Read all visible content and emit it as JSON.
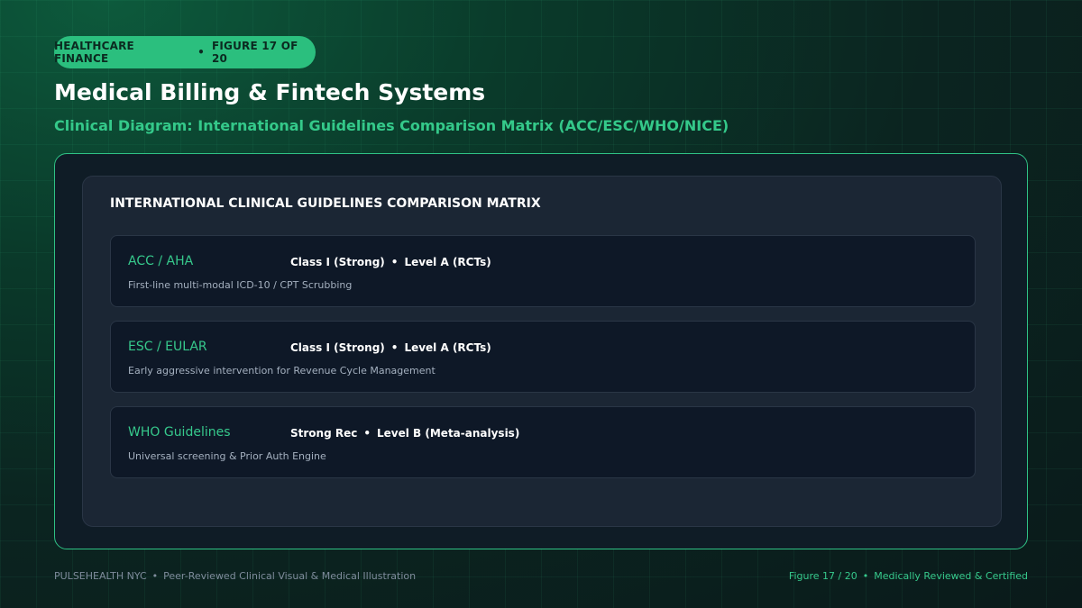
{
  "badge": {
    "section": "HEALTHCARE FINANCE",
    "separator": "•",
    "figure": "FIGURE 17 OF 20"
  },
  "header": {
    "title": "Medical Billing & Fintech Systems",
    "subtitle": "Clinical Diagram: International Guidelines Comparison Matrix (ACC/ESC/WHO/NICE)"
  },
  "matrix": {
    "heading": "INTERNATIONAL CLINICAL GUIDELINES COMPARISON MATRIX",
    "rows": [
      {
        "org": "ACC / AHA",
        "strength": "Class I (Strong)",
        "separator": "•",
        "evidence": "Level A (RCTs)",
        "description": "First-line multi-modal ICD-10 / CPT Scrubbing"
      },
      {
        "org": "ESC / EULAR",
        "strength": "Class I (Strong)",
        "separator": "•",
        "evidence": "Level A (RCTs)",
        "description": "Early aggressive intervention for Revenue Cycle Management"
      },
      {
        "org": "WHO Guidelines",
        "strength": "Strong Rec",
        "separator": "•",
        "evidence": "Level B (Meta-analysis)",
        "description": "Universal screening & Prior Auth Engine"
      }
    ]
  },
  "footer": {
    "brand": "PULSEHEALTH NYC",
    "separator": "•",
    "tagline": "Peer-Reviewed Clinical Visual & Medical Illustration",
    "figure": "Figure 17 / 20",
    "certification": "Medically Reviewed & Certified"
  },
  "colors": {
    "accent": "#2bbf7e",
    "accent_text": "#36c98c",
    "panel": "#1b2634",
    "row": "#0e1827"
  }
}
